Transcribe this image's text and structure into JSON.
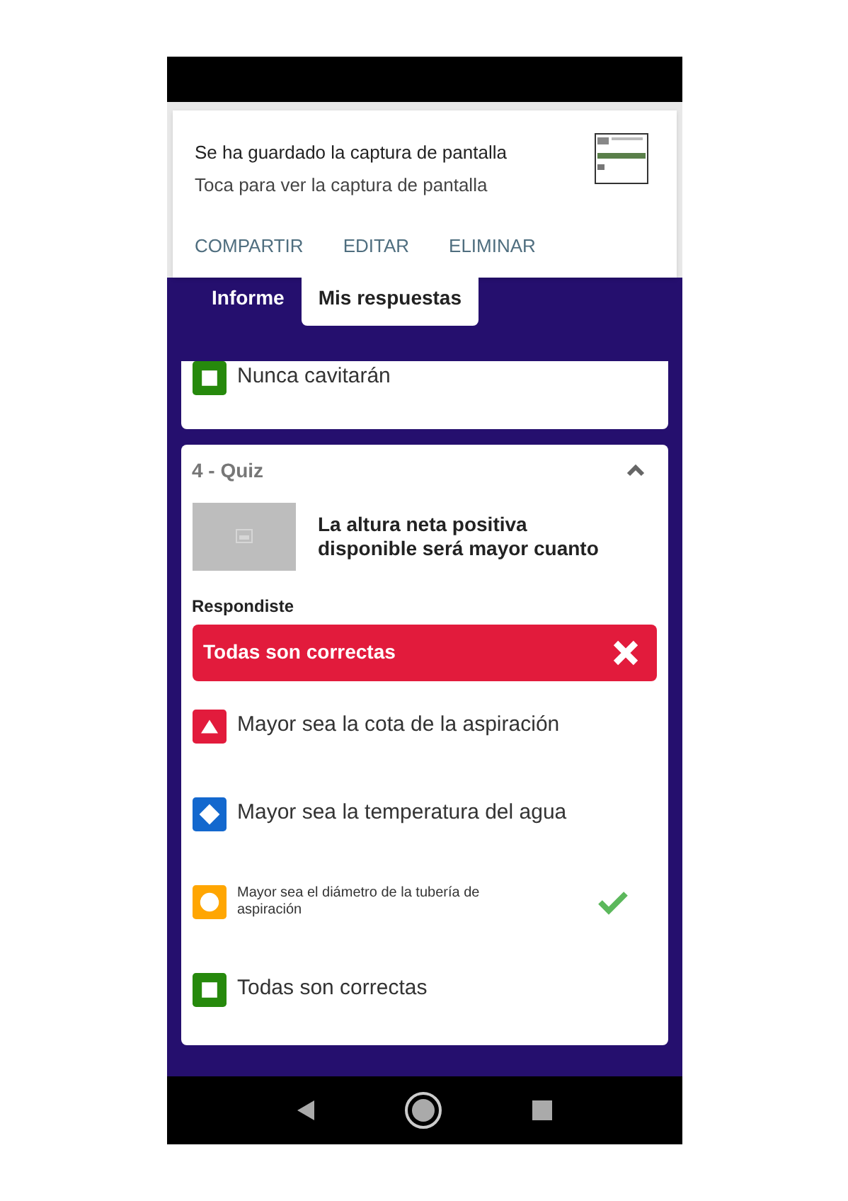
{
  "notification": {
    "title": "Se ha guardado la captura de pantalla",
    "text": "Toca para ver la captura de pantalla",
    "actions": [
      "COMPARTIR",
      "EDITAR",
      "ELIMINAR"
    ]
  },
  "tabs": [
    {
      "label": "Informe",
      "selected": false
    },
    {
      "label": "Mis respuestas",
      "selected": true
    }
  ],
  "previous_card": {
    "answers": [
      {
        "kind": "square",
        "color": "#26890c",
        "text": "Nunca cavitarán"
      }
    ]
  },
  "question": {
    "title": "4 - Quiz",
    "expanded": true,
    "text": "La altura neta positiva disponible será mayor cuanto",
    "answered_label": "Respondiste",
    "answered": {
      "text": "Todas son correctas",
      "correct": false
    },
    "answers": [
      {
        "kind": "triangle",
        "color": "#e21b3c",
        "text": "Mayor sea la cota de la aspiración",
        "correct": false,
        "small_text": false
      },
      {
        "kind": "diamond",
        "color": "#1368ce",
        "text": "Mayor sea la temperatura del agua",
        "correct": false,
        "small_text": false
      },
      {
        "kind": "circle",
        "color": "#ffa602",
        "text": "Mayor sea el diámetro de la tubería de aspiración",
        "correct": true,
        "small_text": true
      },
      {
        "kind": "square",
        "color": "#26890c",
        "text": "Todas son correctas",
        "correct": false,
        "small_text": false
      }
    ]
  }
}
